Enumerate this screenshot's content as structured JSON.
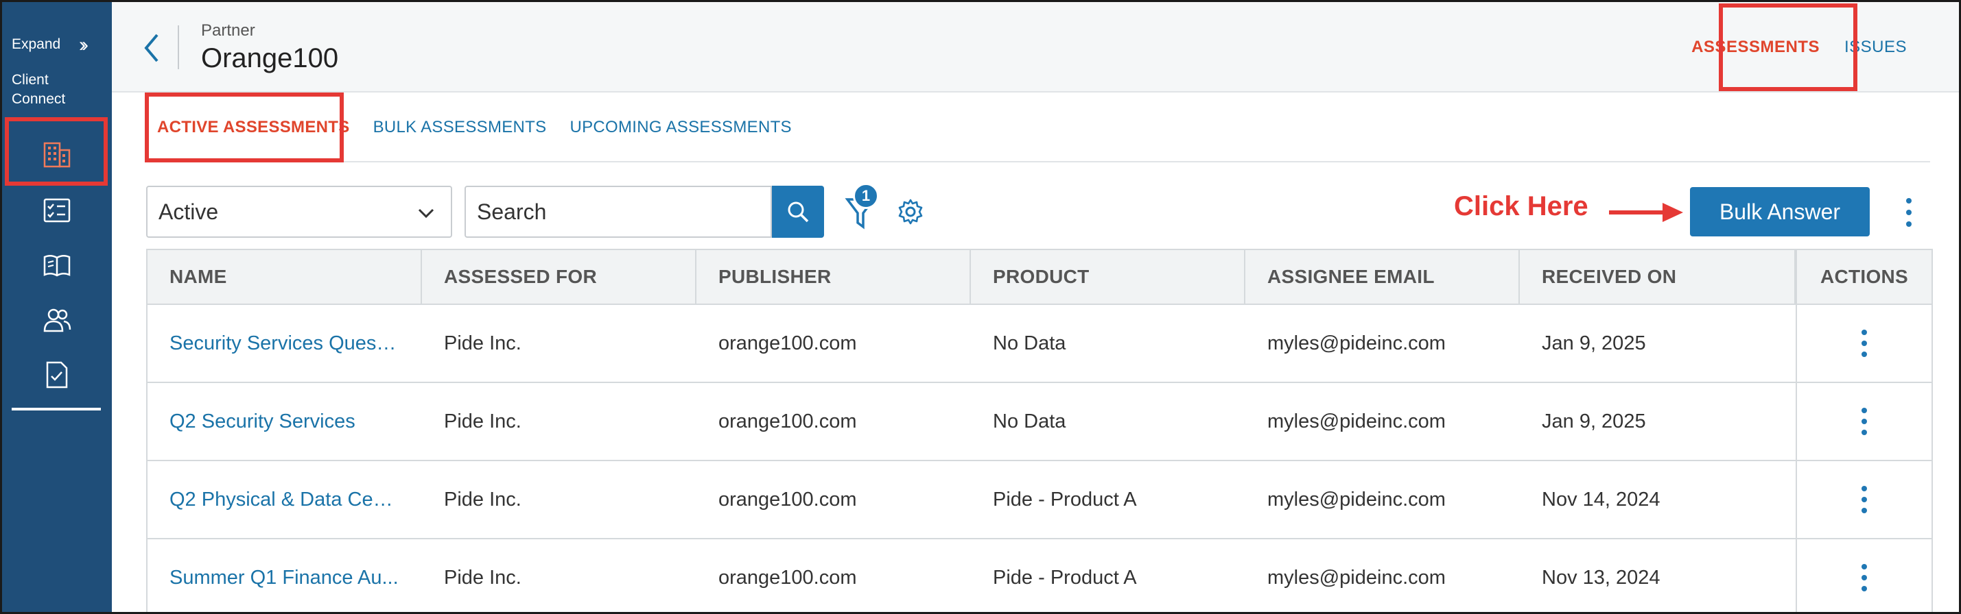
{
  "sidebar": {
    "expand_label": "Expand",
    "client_connect_label": "Client Connect",
    "icons": [
      "building-icon",
      "checklist-icon",
      "book-icon",
      "users-icon",
      "document-check-icon"
    ]
  },
  "header": {
    "breadcrumb": "Partner",
    "title": "Orange100",
    "tabs": [
      {
        "label": "ASSESSMENTS",
        "active": true
      },
      {
        "label": "ISSUES",
        "active": false
      }
    ]
  },
  "subtabs": [
    {
      "label": "ACTIVE ASSESSMENTS",
      "active": true
    },
    {
      "label": "BULK ASSESSMENTS",
      "active": false
    },
    {
      "label": "UPCOMING ASSESSMENTS",
      "active": false
    }
  ],
  "toolbar": {
    "status_select": "Active",
    "search_placeholder": "Search",
    "filter_count": "1",
    "annotation": "Click Here",
    "bulk_answer_label": "Bulk Answer"
  },
  "table": {
    "columns": [
      "NAME",
      "ASSESSED FOR",
      "PUBLISHER",
      "PRODUCT",
      "ASSIGNEE EMAIL",
      "RECEIVED ON",
      "ACTIONS"
    ],
    "rows": [
      {
        "name": "Security Services Questi...",
        "assessed_for": "Pide Inc.",
        "publisher": "orange100.com",
        "product": "No Data",
        "email": "myles@pideinc.com",
        "received": "Jan 9, 2025"
      },
      {
        "name": "Q2 Security Services",
        "assessed_for": "Pide Inc.",
        "publisher": "orange100.com",
        "product": "No Data",
        "email": "myles@pideinc.com",
        "received": "Jan 9, 2025"
      },
      {
        "name": "Q2 Physical & Data Cen...",
        "assessed_for": "Pide Inc.",
        "publisher": "orange100.com",
        "product": "Pide - Product A",
        "email": "myles@pideinc.com",
        "received": "Nov 14, 2024"
      },
      {
        "name": "Summer Q1 Finance Au...",
        "assessed_for": "Pide Inc.",
        "publisher": "orange100.com",
        "product": "Pide - Product A",
        "email": "myles@pideinc.com",
        "received": "Nov 13, 2024"
      }
    ]
  },
  "colors": {
    "sidebar_bg": "#1f4e79",
    "accent_blue": "#1f77b4",
    "active_orange": "#e0452c",
    "highlight_red": "#e53935"
  }
}
